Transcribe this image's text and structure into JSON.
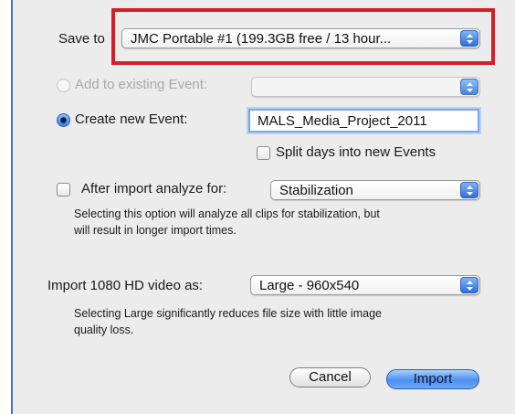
{
  "save_to": {
    "label": "Save to",
    "value": "JMC Portable #1 (199.3GB free / 13 hour..."
  },
  "add_existing": {
    "label": "Add to existing Event:",
    "value": ""
  },
  "create_new": {
    "label": "Create new Event:",
    "event_name": "MALS_Media_Project_2011"
  },
  "split_days": {
    "label": "Split days into new Events"
  },
  "analyze": {
    "label": "After import analyze for:",
    "value": "Stabilization",
    "help_line1": "Selecting this option will analyze all clips for stabilization, but",
    "help_line2": "will result in longer import times."
  },
  "import_hd": {
    "label": "Import 1080 HD video as:",
    "value": "Large - 960x540",
    "help_line1": "Selecting Large significantly reduces file size with little image",
    "help_line2": "quality loss."
  },
  "buttons": {
    "cancel": "Cancel",
    "import": "Import"
  },
  "colors": {
    "highlight_box": "#d32027",
    "accent_blue": "#3a7fe2"
  }
}
